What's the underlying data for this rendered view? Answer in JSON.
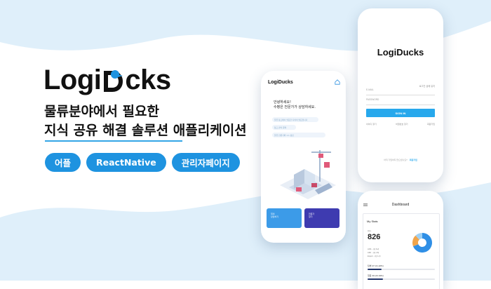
{
  "brand": {
    "logo_left": "Logi",
    "logo_right": "cks",
    "accent": "#1e93e0"
  },
  "headline": {
    "line1": "물류분야에서 필요한",
    "line2": "지식 공유 해결 솔루션 애플리케이션"
  },
  "tags": [
    "어플",
    "ReactNative",
    "관리자페이지"
  ],
  "phone_chat": {
    "header": "LogiDucks",
    "greeting_line1": "안녕하세요!",
    "greeting_line2": "수평은 전문가가 상담하세요.",
    "chips": [
      "물류 창고에서 필요한 지식이 필요합니다",
      "창고 관리 문의",
      "물류 전문가와 1:1 상담"
    ],
    "card_a": "질의\n상담하기",
    "card_b": "전문가\n찾기"
  },
  "phone_login": {
    "logo": "LogiDucks",
    "keep_login": "로그인 상태 유지",
    "email_placeholder": "E-MAIL",
    "password_placeholder": "PASSWORD",
    "signin": "SIGN IN",
    "links": [
      "아이디 찾기",
      "비밀번호 찾기",
      "회원가입"
    ],
    "signup_text": "아직 가입하지 않으셨나요?",
    "signup_link": "회원가입"
  },
  "phone_dash": {
    "title": "Dashboard",
    "stats_title": "My Stats",
    "all_label": "ALL",
    "total": "826",
    "legend": [
      "ANS  ...(Q 6.2)",
      "ASK  ...(Q 1.8)",
      "Expert  ...(Q 1.2)"
    ],
    "donut": [
      {
        "label": "ANS",
        "value": 0.69,
        "color": "#2f8fe6"
      },
      {
        "label": "ASK",
        "value": 0.19,
        "color": "#f0a44a"
      },
      {
        "label": "Expert",
        "value": 0.12,
        "color": "#9fd0f3"
      }
    ],
    "progress": [
      {
        "label": "답변 47 (21.22%)",
        "value": 0.21
      },
      {
        "label": "질문 30 (23.34%)",
        "value": 0.23
      }
    ]
  }
}
